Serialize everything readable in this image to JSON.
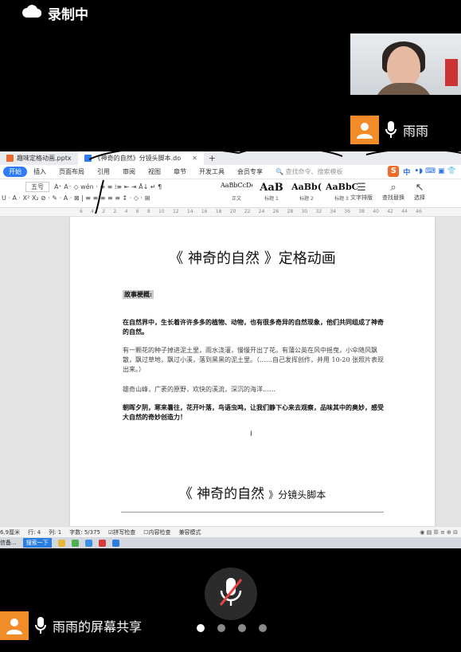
{
  "recording": {
    "label": "录制中",
    "icon": "cloud-icon"
  },
  "participant": {
    "name": "雨雨",
    "icon": "person-icon"
  },
  "share": {
    "label": "雨雨的屏幕共享"
  },
  "tabs": [
    {
      "label": "趣味定格动画.pptx",
      "color": "#e8692c"
    },
    {
      "label": "《神奇的自然》分镜头脚本.do",
      "color": "#2f7df6"
    }
  ],
  "menu": {
    "items": [
      "开始",
      "插入",
      "页面布局",
      "引用",
      "审阅",
      "视图",
      "章节",
      "开发工具",
      "会员专享"
    ],
    "search": "查找命令、搜索模板",
    "ime": "中"
  },
  "ribbon": {
    "font_size": "五号",
    "styles": [
      {
        "sample": "AaBbCcDd",
        "name": "正文"
      },
      {
        "sample": "AaB",
        "name": "标题 1"
      },
      {
        "sample": "AaBb(",
        "name": "标题 2"
      },
      {
        "sample": "AaBbC",
        "name": "标题 3"
      }
    ],
    "text_layout": "文字排版",
    "find_replace": "查找替换",
    "select": "选择"
  },
  "ruler": [
    "6",
    "4",
    "2",
    "2",
    "4",
    "6",
    "8",
    "10",
    "12",
    "14",
    "16",
    "18",
    "20",
    "22",
    "24",
    "26",
    "28",
    "30",
    "32",
    "34",
    "36",
    "38",
    "40",
    "42",
    "44",
    "46"
  ],
  "document": {
    "title": "《 神奇的自然 》定格动画",
    "outline_label": "故事梗概:",
    "para1": "在自然界中，生长着许许多多的植物、动物，也有很多奇异的自然现象，他们共同组成了神奇的自然。",
    "para2": "有一颗花的种子掉进泥土里，雨水浇灌，慢慢开出了花。有蒲公英在风中摇曳，小伞随风飘散，飘过草地，飘过小溪，落到黑黑的泥土里。（……自己发挥创作，并用 10-20 张照片表现出来。）",
    "para3": "雄奇山峰，广袤的原野，欢快的溪流，深沉的海洋……",
    "para4": "朝晖夕阴，寒来暑往，花开叶落，鸟语虫鸣，让我们静下心来去观察，品味其中的奥妙，感受大自然的奇妙创造力！",
    "cursor": "I",
    "title2_main": "《 神奇的自然",
    "title2_sub": "》分镜头脚本"
  },
  "status": {
    "position": "6.9厘米",
    "line": "行: 4",
    "column": "列: 1",
    "word_count": "字数: 5/375",
    "spell_check": "拼写检查",
    "content_check": "内容检查",
    "compat_mode": "兼容模式"
  },
  "taskbar": {
    "left": "信备...",
    "search": "搜索一下"
  },
  "pager": {
    "count": 4,
    "active": 0
  }
}
